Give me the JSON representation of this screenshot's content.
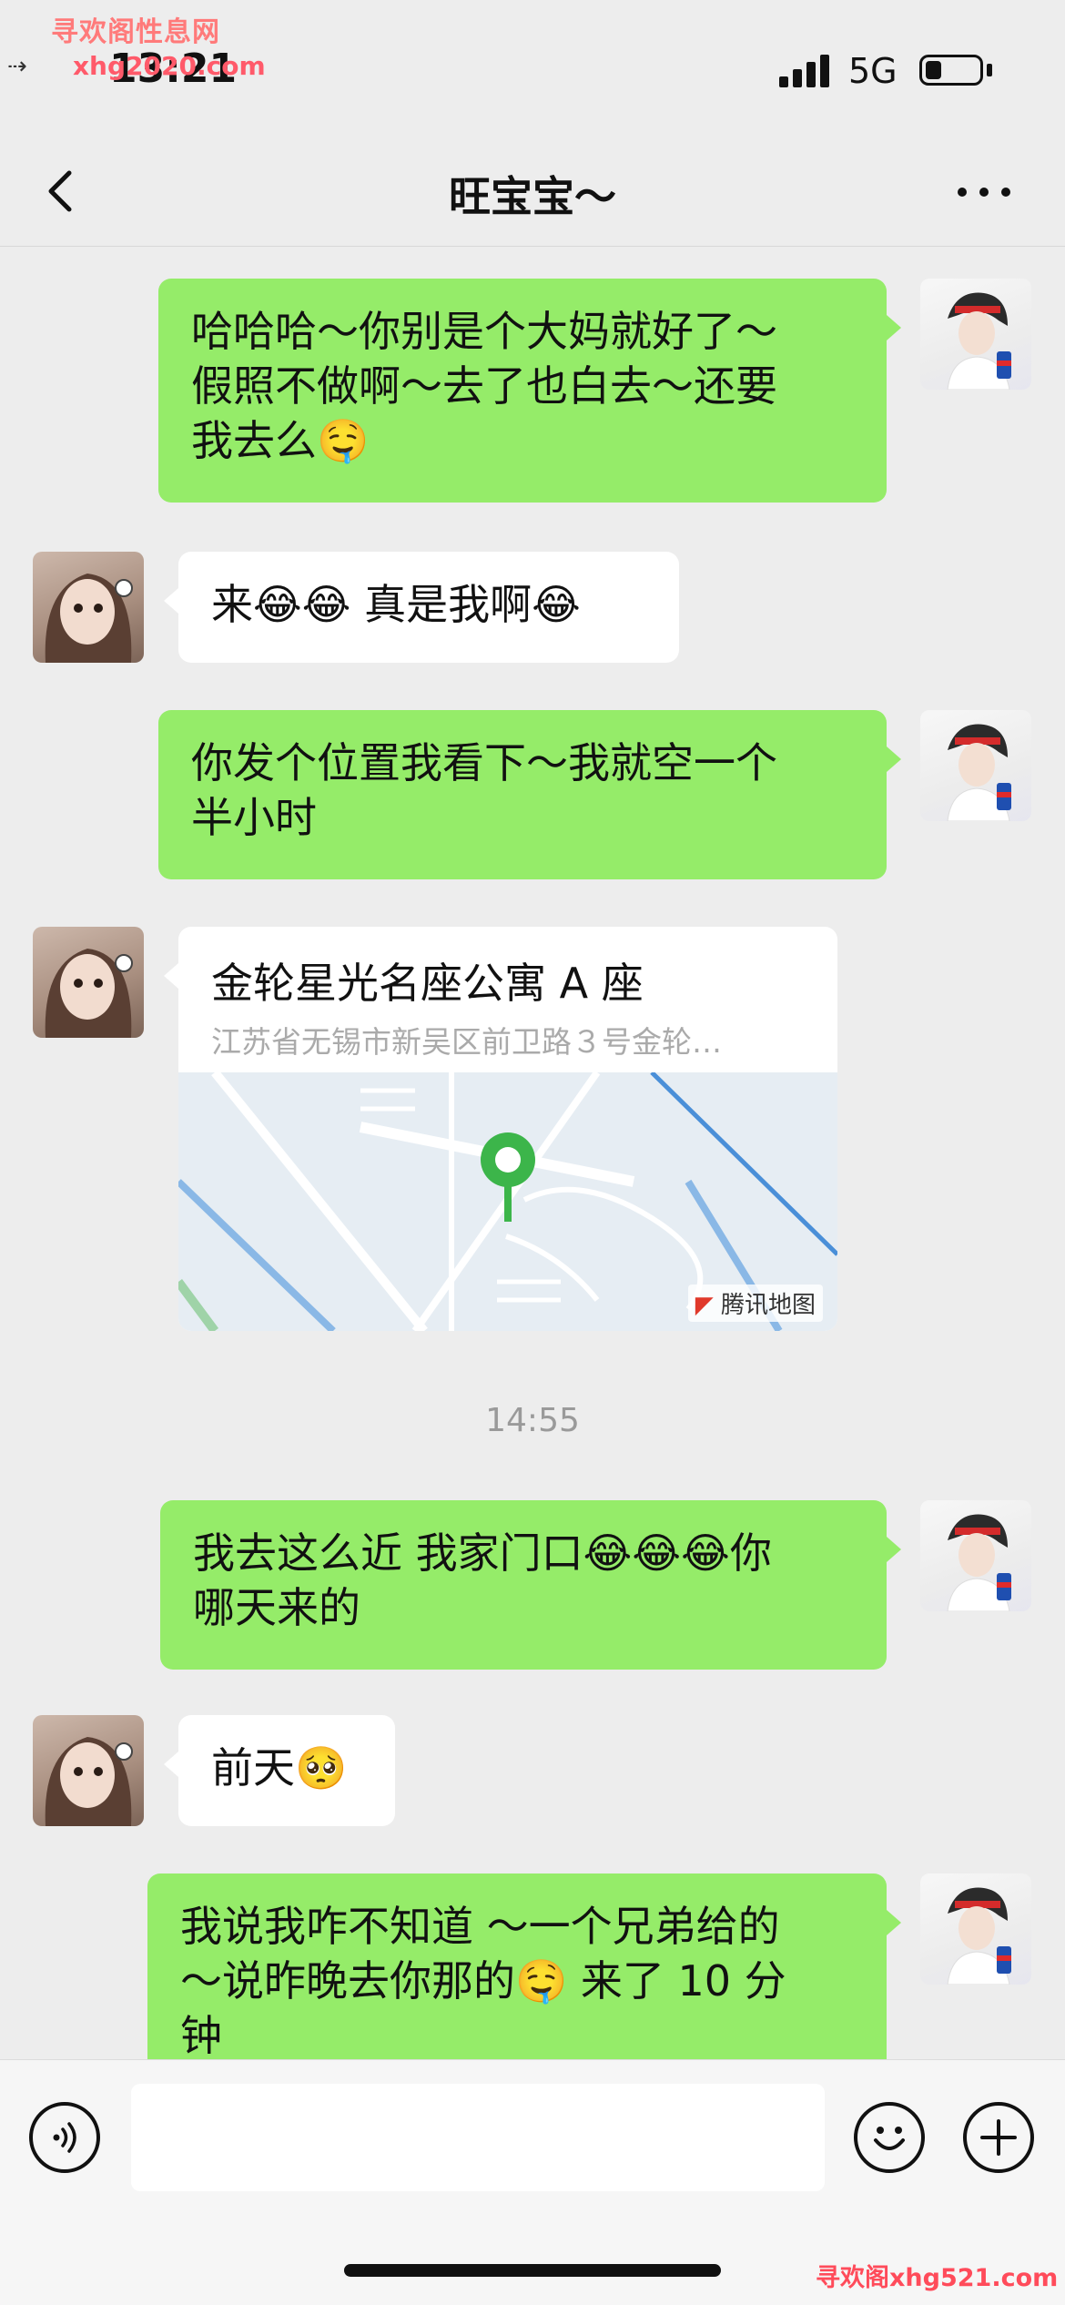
{
  "watermarks": {
    "top_site_name": "寻欢阁性息网",
    "top_domain": "xhg2020.com",
    "bottom": "寻欢阁xhg521.com"
  },
  "status_bar": {
    "time": "13:21",
    "network": "5G",
    "battery_level": 0.3
  },
  "nav": {
    "title": "旺宝宝～",
    "back_icon": "chevron-left-icon",
    "more_icon": "more-dots-icon"
  },
  "messages": [
    {
      "sender": "me",
      "lines": [
        "哈哈哈～你别是个大妈就好了～",
        "假照不做啊～去了也白去～还要",
        "我去么🤤"
      ]
    },
    {
      "sender": "her",
      "lines": [
        "来😂😂 真是我啊😂"
      ]
    },
    {
      "sender": "me",
      "lines": [
        "你发个位置我看下～我就空一个",
        "半小时"
      ]
    },
    {
      "sender": "her",
      "type": "location",
      "title": "金轮星光名座公寓 A 座",
      "address": "江苏省无锡市新吴区前卫路３号金轮…",
      "map_credit": "腾讯地图"
    },
    {
      "sender": "me",
      "lines": [
        "我去这么近 我家门口😂😂😂你",
        "哪天来的"
      ]
    },
    {
      "sender": "her",
      "lines": [
        "前天🥺"
      ]
    },
    {
      "sender": "me",
      "lines": [
        "我说我咋不知道 ～一个兄弟给的",
        "～说昨晚去你那的🤤 来了 10 分",
        "钟"
      ]
    }
  ],
  "timestamp": "14:55",
  "input_bar": {
    "voice_icon": "voice-icon",
    "emoji_icon": "emoji-icon",
    "plus_icon": "plus-icon",
    "placeholder": ""
  },
  "colors": {
    "my_bubble": "#95ec69",
    "her_bubble": "#ffffff",
    "background": "#ededed",
    "map_pin": "#3cb54a"
  }
}
